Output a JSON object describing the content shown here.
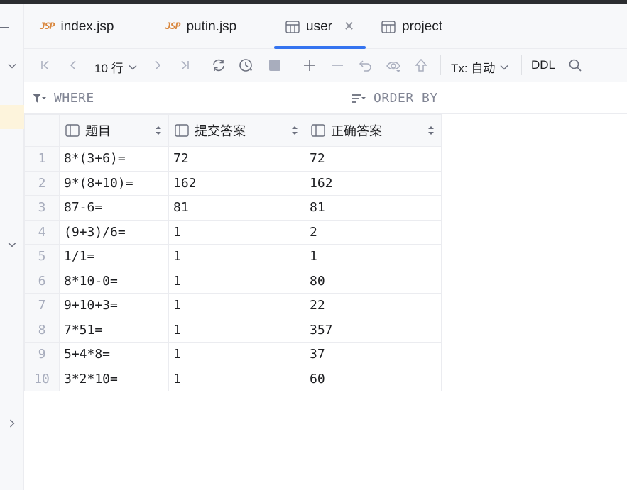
{
  "tabs": [
    {
      "label": "index.jsp",
      "icon": "jsp-file-icon",
      "badge": "JSP"
    },
    {
      "label": "putin.jsp",
      "icon": "jsp-file-icon",
      "badge": "JSP"
    },
    {
      "label": "user",
      "icon": "table-icon",
      "active": true
    },
    {
      "label": "project",
      "icon": "table-icon"
    }
  ],
  "toolbar": {
    "page_size": "10 行",
    "tx_mode": "Tx: 自动",
    "ddl_label": "DDL"
  },
  "filter": {
    "where_placeholder": "WHERE",
    "order_placeholder": "ORDER BY"
  },
  "table": {
    "columns": [
      "题目",
      "提交答案",
      "正确答案"
    ],
    "rows": [
      {
        "n": "1",
        "q": "8*(3+6)=",
        "submitted": "72",
        "correct": "72"
      },
      {
        "n": "2",
        "q": "9*(8+10)=",
        "submitted": "162",
        "correct": "162"
      },
      {
        "n": "3",
        "q": "87-6=",
        "submitted": "81",
        "correct": "81"
      },
      {
        "n": "4",
        "q": "(9+3)/6=",
        "submitted": "1",
        "correct": "2"
      },
      {
        "n": "5",
        "q": "1/1=",
        "submitted": "1",
        "correct": "1"
      },
      {
        "n": "6",
        "q": "8*10-0=",
        "submitted": "1",
        "correct": "80"
      },
      {
        "n": "7",
        "q": "9+10+3=",
        "submitted": "1",
        "correct": "22"
      },
      {
        "n": "8",
        "q": "7*51=",
        "submitted": "1",
        "correct": "357"
      },
      {
        "n": "9",
        "q": "5+4*8=",
        "submitted": "1",
        "correct": "37"
      },
      {
        "n": "10",
        "q": "3*2*10=",
        "submitted": "1",
        "correct": "60"
      }
    ]
  },
  "colors": {
    "accent": "#3574f0",
    "jsp_badge": "#d9873e",
    "panel_bg": "#f7f8fa",
    "border": "#ebecf0",
    "highlight": "#fdf4dc"
  }
}
